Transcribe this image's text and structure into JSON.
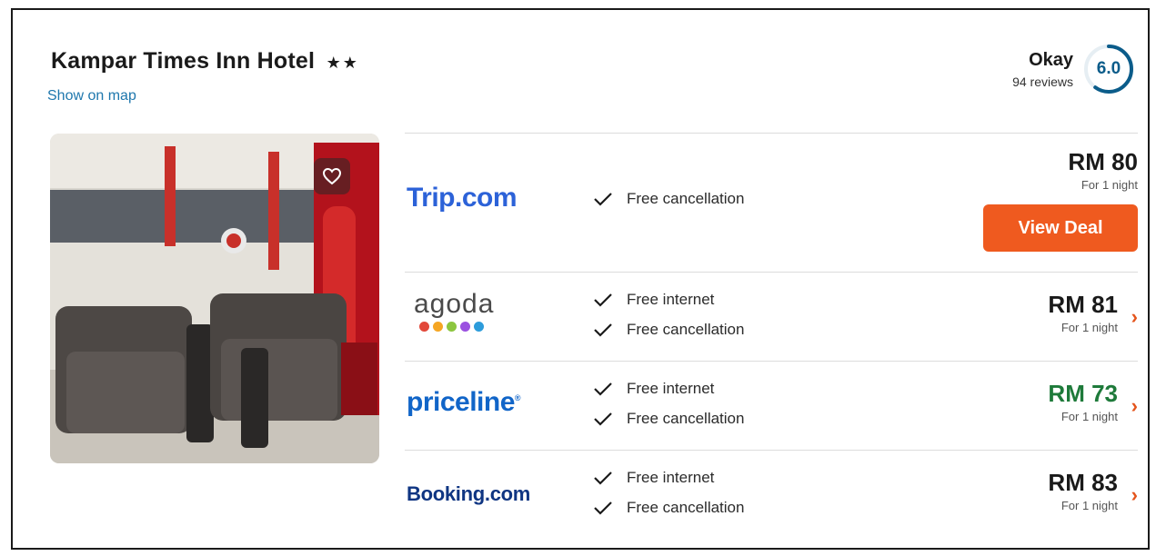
{
  "hotel": {
    "name": "Kampar Times Inn Hotel",
    "stars": "★★",
    "map_link": "Show on map"
  },
  "rating": {
    "label": "Okay",
    "reviews": "94 reviews",
    "score": "6.0",
    "score_fraction": 0.6
  },
  "colors": {
    "accent_orange": "#ef5a1f",
    "score_blue": "#0b5c8a",
    "good_price_green": "#1e7a3a",
    "link_blue": "#1e77ad"
  },
  "offers": [
    {
      "provider": "Trip.com",
      "features": [
        "Free cancellation"
      ],
      "price": "RM 80",
      "per_night": "For 1 night",
      "button": "View Deal"
    },
    {
      "provider": "agoda",
      "features": [
        "Free internet",
        "Free cancellation"
      ],
      "price": "RM 81",
      "per_night": "For 1 night"
    },
    {
      "provider": "priceline",
      "features": [
        "Free internet",
        "Free cancellation"
      ],
      "price": "RM 73",
      "per_night": "For 1 night"
    },
    {
      "provider": "Booking.com",
      "features": [
        "Free internet",
        "Free cancellation"
      ],
      "price": "RM 83",
      "per_night": "For 1 night"
    }
  ],
  "icons": {
    "favorite": "heart-icon",
    "feature": "check-icon",
    "more": "chevron-right-icon"
  }
}
